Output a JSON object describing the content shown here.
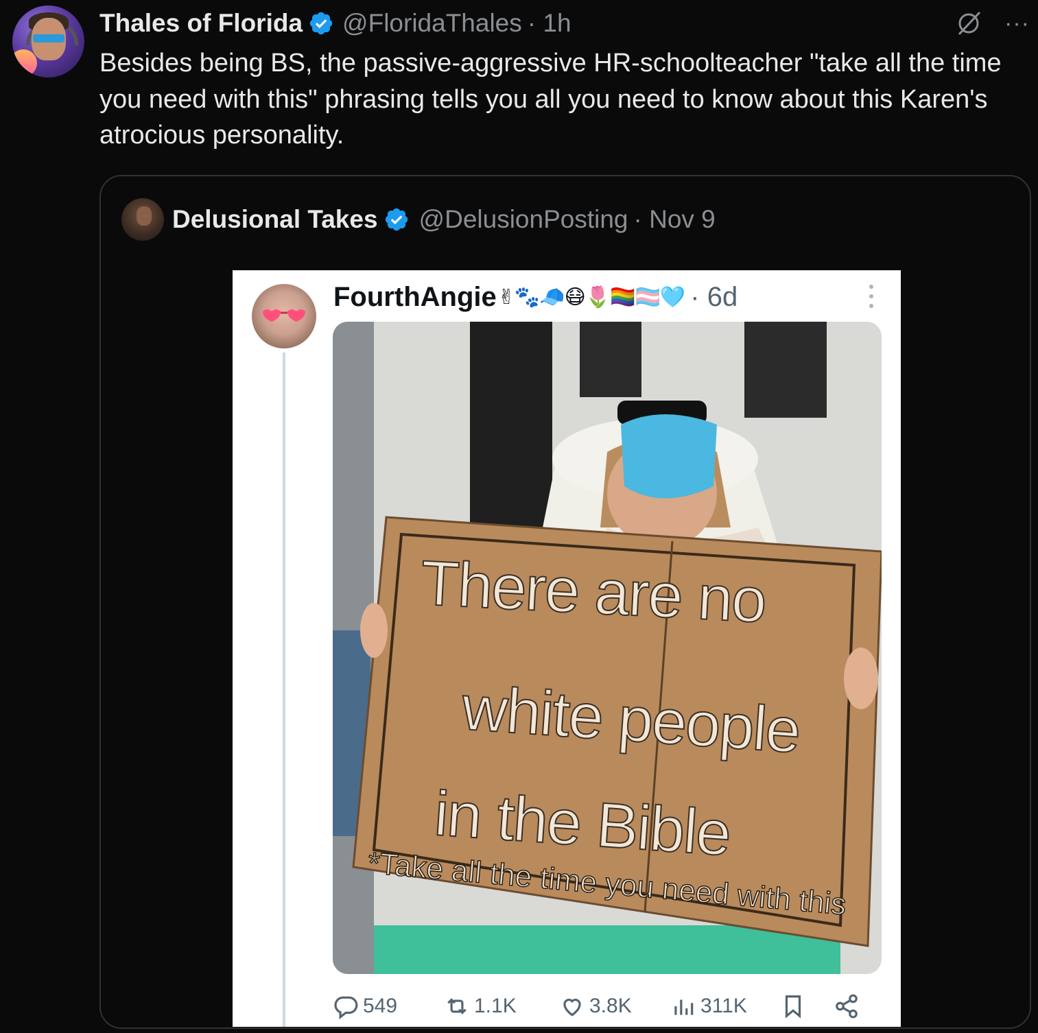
{
  "post": {
    "author_name": "Thales of Florida",
    "handle": "@FloridaThales",
    "time": "· 1h",
    "text": "Besides being BS, the passive-aggressive HR-schoolteacher \"take all the time you need with this\" phrasing tells you all you need to know about this Karen's atrocious personality.",
    "more_label": "···"
  },
  "quoted": {
    "author_name": "Delusional Takes",
    "handle": "@DelusionPosting",
    "time": "· Nov 9"
  },
  "screenshot": {
    "author_name": "FourthAngie",
    "emojis": "✌🐾🧢😷🌷🏳️‍🌈🏳️‍⚧️🩵",
    "time": "· 6d",
    "sign_lines": [
      "There are no",
      "white people",
      "in the Bible",
      "*Take all the time you need with this"
    ],
    "actions": {
      "replies": "549",
      "reposts": "1.1K",
      "likes": "3.8K",
      "views": "311K"
    }
  },
  "colors": {
    "background": "#0a0a0a",
    "text": "#e7e9ea",
    "muted": "#8b8f94",
    "verified": "#1d9bf0",
    "border": "#2f3336"
  },
  "icons": [
    "verified-badge-icon",
    "grok-icon",
    "more-icon",
    "reply-icon",
    "repost-icon",
    "like-icon",
    "views-icon",
    "bookmark-icon",
    "share-icon"
  ]
}
